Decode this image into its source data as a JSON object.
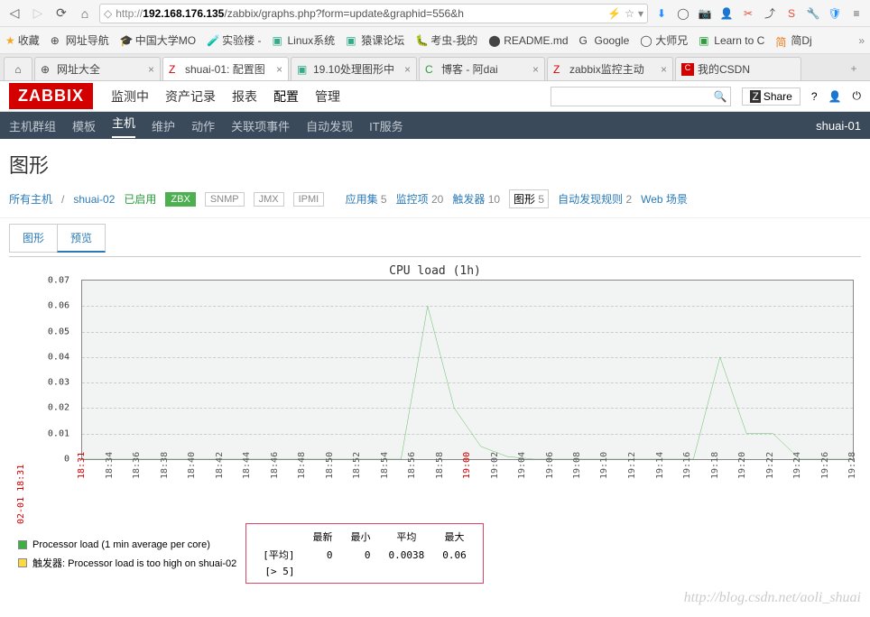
{
  "browser": {
    "url_prefix": "http://",
    "url_host": "192.168.176.135",
    "url_path": "/zabbix/graphs.php?form=update&graphid=556&h"
  },
  "bookmarks": [
    {
      "label": "收藏"
    },
    {
      "label": "网址导航"
    },
    {
      "label": "中国大学MO"
    },
    {
      "label": "实验楼 -"
    },
    {
      "label": "Linux系统"
    },
    {
      "label": "猿课论坛"
    },
    {
      "label": "考虫-我的"
    },
    {
      "label": "README.md"
    },
    {
      "label": "Google"
    },
    {
      "label": "大师兄"
    },
    {
      "label": "Learn to C"
    },
    {
      "label": "简Dj"
    }
  ],
  "tabs": [
    {
      "label": "网址大全"
    },
    {
      "label": "shuai-01: 配置图",
      "active": true
    },
    {
      "label": "19.10处理图形中"
    },
    {
      "label": "博客 - 阿dai"
    },
    {
      "label": "zabbix监控主动"
    },
    {
      "label": "我的CSDN"
    }
  ],
  "zabbix": {
    "logo": "ZABBIX",
    "nav": [
      "监测中",
      "资产记录",
      "报表",
      "配置",
      "管理"
    ],
    "nav_active": "配置",
    "subnav": [
      "主机群组",
      "模板",
      "主机",
      "维护",
      "动作",
      "关联项事件",
      "自动发现",
      "IT服务"
    ],
    "subnav_active": "主机",
    "hostname": "shuai-01",
    "share": "Share"
  },
  "page": {
    "title": "图形",
    "crumb_all": "所有主机",
    "crumb_host": "shuai-02",
    "enabled": "已启用",
    "badges": [
      "ZBX",
      "SNMP",
      "JMX",
      "IPMI"
    ],
    "links": [
      {
        "label": "应用集",
        "count": "5"
      },
      {
        "label": "监控项",
        "count": "20"
      },
      {
        "label": "触发器",
        "count": "10"
      },
      {
        "label": "图形",
        "count": "5",
        "sel": true
      },
      {
        "label": "自动发现规则",
        "count": "2"
      },
      {
        "label": "Web 场景",
        "count": ""
      }
    ],
    "subtabs": [
      "图形",
      "预览"
    ],
    "subtab_active": "预览"
  },
  "chart_data": {
    "type": "line",
    "title": "CPU load (1h)",
    "ylabel": "",
    "ylim": [
      0,
      0.07
    ],
    "yticks": [
      0,
      0.01,
      0.02,
      0.03,
      0.04,
      0.05,
      0.06,
      0.07
    ],
    "x_start": "02-01 18:31",
    "xticks": [
      "18:31",
      "18:34",
      "18:36",
      "18:38",
      "18:40",
      "18:42",
      "18:44",
      "18:46",
      "18:48",
      "18:50",
      "18:52",
      "18:54",
      "18:56",
      "18:58",
      "19:00",
      "19:02",
      "19:04",
      "19:06",
      "19:08",
      "19:10",
      "19:12",
      "19:14",
      "19:16",
      "19:18",
      "19:20",
      "19:22",
      "19:24",
      "19:26",
      "19:28"
    ],
    "xticks_red": [
      "18:31",
      "19:00"
    ],
    "series": [
      {
        "name": "Processor load (1 min average per core)",
        "color": "#3cb043",
        "values": [
          0,
          0,
          0,
          0,
          0,
          0,
          0,
          0,
          0,
          0,
          0,
          0,
          0,
          0.06,
          0.02,
          0.005,
          0.001,
          0,
          0,
          0,
          0,
          0,
          0,
          0,
          0.04,
          0.01,
          0.01,
          0,
          0,
          0
        ]
      }
    ],
    "trigger": {
      "name": "触发器: Processor load is too high on shuai-02",
      "cond": "[> 5]",
      "color": "#ffd740"
    },
    "stats": {
      "headers": [
        "最新",
        "最小",
        "平均",
        "最大"
      ],
      "row_label": "[平均]",
      "row": [
        "0",
        "0",
        "0.0038",
        "0.06"
      ]
    }
  },
  "watermark": "http://blog.csdn.net/aoli_shuai"
}
